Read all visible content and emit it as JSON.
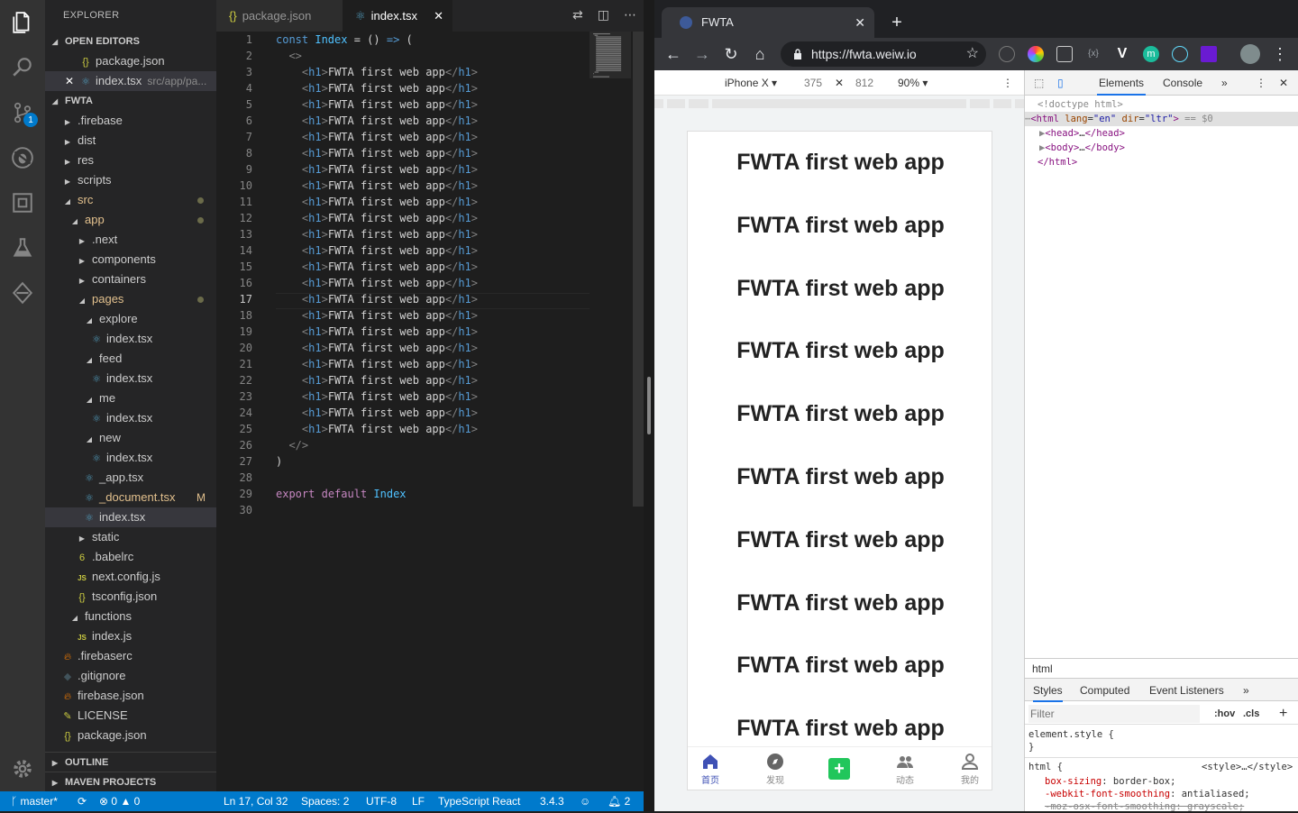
{
  "vscode": {
    "explorer_title": "EXPLORER",
    "open_editors_label": "OPEN EDITORS",
    "open_editors": [
      {
        "icon": "{}",
        "name": "package.json",
        "desc": ""
      },
      {
        "icon": "⚛",
        "name": "index.tsx",
        "desc": "src/app/pa..."
      }
    ],
    "project_label": "FWTA",
    "scm_badge": "1",
    "tree": [
      {
        "name": ".firebase",
        "depth": 0,
        "kind": "folder",
        "open": false
      },
      {
        "name": "dist",
        "depth": 0,
        "kind": "folder",
        "open": false
      },
      {
        "name": "res",
        "depth": 0,
        "kind": "folder",
        "open": false
      },
      {
        "name": "scripts",
        "depth": 0,
        "kind": "folder",
        "open": false
      },
      {
        "name": "src",
        "depth": 0,
        "kind": "folder",
        "open": true,
        "mod": true
      },
      {
        "name": "app",
        "depth": 1,
        "kind": "folder",
        "open": true,
        "mod": true
      },
      {
        "name": ".next",
        "depth": 2,
        "kind": "folder",
        "open": false
      },
      {
        "name": "components",
        "depth": 2,
        "kind": "folder",
        "open": false
      },
      {
        "name": "containers",
        "depth": 2,
        "kind": "folder",
        "open": false
      },
      {
        "name": "pages",
        "depth": 2,
        "kind": "folder",
        "open": true,
        "mod": true
      },
      {
        "name": "explore",
        "depth": 3,
        "kind": "folder",
        "open": true
      },
      {
        "name": "index.tsx",
        "depth": 4,
        "kind": "react"
      },
      {
        "name": "feed",
        "depth": 3,
        "kind": "folder",
        "open": true
      },
      {
        "name": "index.tsx",
        "depth": 4,
        "kind": "react"
      },
      {
        "name": "me",
        "depth": 3,
        "kind": "folder",
        "open": true
      },
      {
        "name": "index.tsx",
        "depth": 4,
        "kind": "react"
      },
      {
        "name": "new",
        "depth": 3,
        "kind": "folder",
        "open": true
      },
      {
        "name": "index.tsx",
        "depth": 4,
        "kind": "react"
      },
      {
        "name": "_app.tsx",
        "depth": 3,
        "kind": "react"
      },
      {
        "name": "_document.tsx",
        "depth": 3,
        "kind": "react",
        "modflag": "M"
      },
      {
        "name": "index.tsx",
        "depth": 3,
        "kind": "react",
        "selected": true
      },
      {
        "name": "static",
        "depth": 2,
        "kind": "folder",
        "open": false
      },
      {
        "name": ".babelrc",
        "depth": 2,
        "kind": "babel"
      },
      {
        "name": "next.config.js",
        "depth": 2,
        "kind": "js"
      },
      {
        "name": "tsconfig.json",
        "depth": 2,
        "kind": "json"
      },
      {
        "name": "functions",
        "depth": 1,
        "kind": "folder",
        "open": true
      },
      {
        "name": "index.js",
        "depth": 2,
        "kind": "js"
      },
      {
        "name": ".firebaserc",
        "depth": 0,
        "kind": "firebase"
      },
      {
        "name": ".gitignore",
        "depth": 0,
        "kind": "git"
      },
      {
        "name": "firebase.json",
        "depth": 0,
        "kind": "firebase"
      },
      {
        "name": "LICENSE",
        "depth": 0,
        "kind": "license"
      },
      {
        "name": "package.json",
        "depth": 0,
        "kind": "json"
      }
    ],
    "outline_label": "OUTLINE",
    "maven_label": "MAVEN PROJECTS",
    "tabs": [
      {
        "icon": "{}",
        "label": "package.json",
        "active": false
      },
      {
        "icon": "⚛",
        "label": "index.tsx",
        "active": true
      }
    ],
    "current_line": 17,
    "code_lines": [
      "const Index = () => (",
      "  <>",
      "    <h1>FWTA first web app</h1>",
      "    <h1>FWTA first web app</h1>",
      "    <h1>FWTA first web app</h1>",
      "    <h1>FWTA first web app</h1>",
      "    <h1>FWTA first web app</h1>",
      "    <h1>FWTA first web app</h1>",
      "    <h1>FWTA first web app</h1>",
      "    <h1>FWTA first web app</h1>",
      "    <h1>FWTA first web app</h1>",
      "    <h1>FWTA first web app</h1>",
      "    <h1>FWTA first web app</h1>",
      "    <h1>FWTA first web app</h1>",
      "    <h1>FWTA first web app</h1>",
      "    <h1>FWTA first web app</h1>",
      "    <h1>FWTA first web app</h1>",
      "    <h1>FWTA first web app</h1>",
      "    <h1>FWTA first web app</h1>",
      "    <h1>FWTA first web app</h1>",
      "    <h1>FWTA first web app</h1>",
      "    <h1>FWTA first web app</h1>",
      "    <h1>FWTA first web app</h1>",
      "    <h1>FWTA first web app</h1>",
      "    <h1>FWTA first web app</h1>",
      "  </>",
      ")",
      "",
      "export default Index",
      ""
    ],
    "status": {
      "branch": "master*",
      "errors": "0",
      "warnings": "0",
      "position": "Ln 17, Col 32",
      "spaces": "Spaces: 2",
      "encoding": "UTF-8",
      "eol": "LF",
      "language": "TypeScript React",
      "version": "3.4.3",
      "notifications": "2"
    },
    "colors": {
      "accent": "#007acc",
      "modified": "#e2c08d"
    }
  },
  "chrome": {
    "tab_title": "FWTA",
    "url": "https://fwta.weiw.io",
    "device": "iPhone X",
    "width": "375",
    "height": "812",
    "zoom": "90%",
    "page_headings": [
      "FWTA first web app",
      "FWTA first web app",
      "FWTA first web app",
      "FWTA first web app",
      "FWTA first web app",
      "FWTA first web app",
      "FWTA first web app",
      "FWTA first web app",
      "FWTA first web app",
      "FWTA first web app"
    ],
    "tabbar": [
      {
        "label": "首页",
        "icon": "home-icon",
        "active": true
      },
      {
        "label": "发现",
        "icon": "compass-icon",
        "active": false
      },
      {
        "label": "",
        "icon": "plus-icon",
        "active": false
      },
      {
        "label": "动态",
        "icon": "people-icon",
        "active": false
      },
      {
        "label": "我的",
        "icon": "person-icon",
        "active": false
      }
    ]
  },
  "devtools": {
    "tabs": [
      "Elements",
      "Console"
    ],
    "dom": {
      "doctype": "<!doctype html>",
      "html_tag": "html",
      "lang_attr": "lang",
      "lang_val": "en",
      "dir_attr": "dir",
      "dir_val": "ltr",
      "selected_marker": "== $0",
      "head": "head",
      "body": "body",
      "close_html": "</html>"
    },
    "breadcrumb": "html",
    "style_tabs": [
      "Styles",
      "Computed",
      "Event Listeners"
    ],
    "filter_placeholder": "Filter",
    "hov": ":hov",
    "cls": ".cls",
    "rules": {
      "element_style": "element.style {",
      "close": "}",
      "html_selector": "html {",
      "source": "<style>…</style>",
      "prop1": "box-sizing",
      "val1": "border-box;",
      "prop2": "-webkit-font-smoothing",
      "val2": "antialiased;",
      "prop3": "-moz-osx-font-smoothing: grayscale;"
    }
  }
}
